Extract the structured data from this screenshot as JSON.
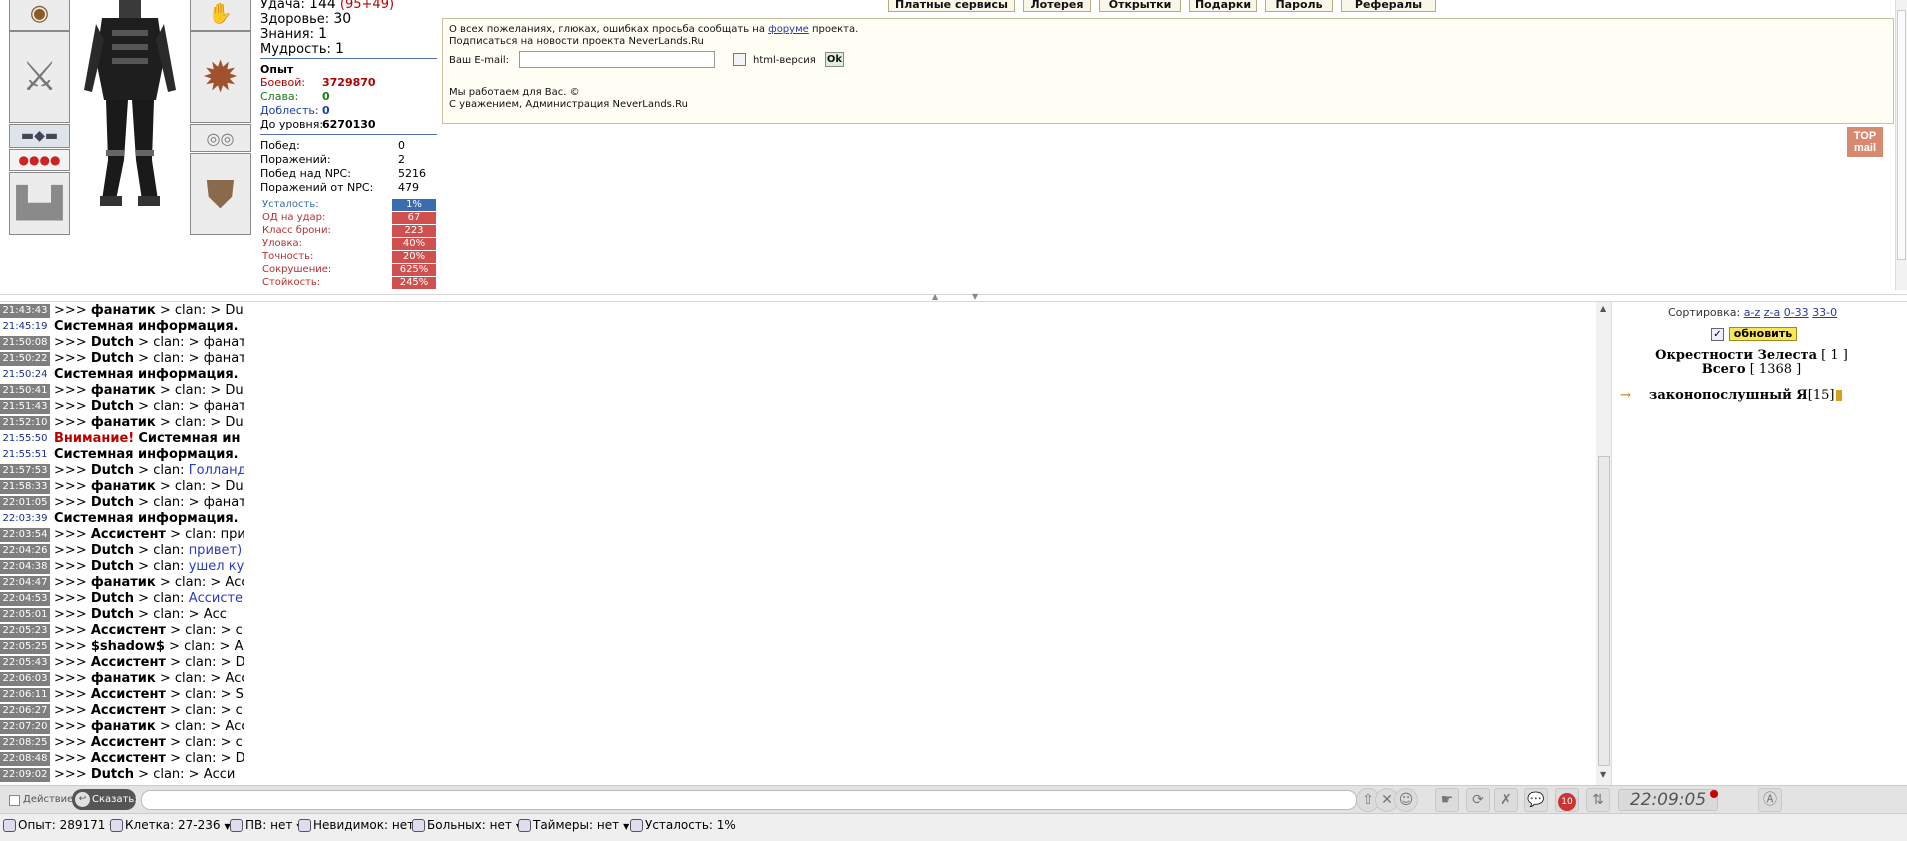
{
  "character": {
    "stats": [
      {
        "label": "Удача:",
        "value": "144",
        "extra": "(95+49)"
      },
      {
        "label": "Здоровье:",
        "value": "30"
      },
      {
        "label": "Знания:",
        "value": "1"
      },
      {
        "label": "Мудрость:",
        "value": "1"
      }
    ],
    "exp_title": "Опыт",
    "exp": [
      {
        "label": "Боевой:",
        "value": "3729870",
        "color": "#b00000"
      },
      {
        "label": "Слава:",
        "value": "0",
        "color": "#1b7a1b"
      },
      {
        "label": "Доблесть:",
        "value": "0",
        "color": "#1a3fa8"
      },
      {
        "label": "До уровня:",
        "value": "6270130",
        "color": "#000000"
      }
    ],
    "battles": [
      {
        "label": "Побед:",
        "value": "0"
      },
      {
        "label": "Поражений:",
        "value": "2"
      },
      {
        "label": "Побед над NPC:",
        "value": "5216"
      },
      {
        "label": "Поражений от NPC:",
        "value": "479"
      }
    ],
    "modifiers": [
      {
        "label": "Усталость:",
        "value": "1%",
        "color": "#3a6cb0"
      },
      {
        "label": "ОД на удар:",
        "value": "67",
        "color": "#d05050"
      },
      {
        "label": "Класс брони:",
        "value": "223",
        "color": "#d05050"
      },
      {
        "label": "Уловка:",
        "value": "40%",
        "color": "#d05050"
      },
      {
        "label": "Точность:",
        "value": "20%",
        "color": "#d05050"
      },
      {
        "label": "Сокрушение:",
        "value": "625%",
        "color": "#d05050"
      },
      {
        "label": "Стойкость:",
        "value": "245%",
        "color": "#d05050"
      }
    ],
    "equipment_icons": [
      "helmet-icon",
      "axe-icon",
      "belt-icon",
      "potions-icon",
      "boots-icon",
      "gauntlet-icon",
      "spiked-shield-icon",
      "rings-icon",
      "armor-icon"
    ]
  },
  "tabs": [
    "Платные сервисы",
    "Лотерея",
    "Открытки",
    "Подарки",
    "Пароль",
    "Рефералы"
  ],
  "news": {
    "line1_before": "О всех пожеланиях, глюках, ошибках просьба сообщать на",
    "line1_link": "форуме",
    "line1_after": "проекта.",
    "line2": "Подписаться на новости проекта NeverLands.Ru",
    "email_label": "Ваш E-mail:",
    "email_value": "",
    "html_label": "html-версия",
    "ok": "Ok",
    "footer1": "Мы работаем для Вас. ©",
    "footer2": "С уважением, Администрация NeverLands.Ru",
    "topmail": "TOP mail"
  },
  "chat": [
    {
      "time": "21:43:43",
      "ts": "g",
      "parts": [
        [
          ">>> ",
          ""
        ],
        [
          "фанатик",
          "b"
        ],
        [
          " > clan: > Dut",
          ""
        ]
      ]
    },
    {
      "time": "21:45:19",
      "ts": "b",
      "parts": [
        [
          "Системная информация.",
          "b"
        ]
      ]
    },
    {
      "time": "21:50:08",
      "ts": "g",
      "parts": [
        [
          ">>> ",
          ""
        ],
        [
          "Dutch",
          "b"
        ],
        [
          " > clan: > фанат",
          ""
        ]
      ]
    },
    {
      "time": "21:50:22",
      "ts": "g",
      "parts": [
        [
          ">>> ",
          ""
        ],
        [
          "Dutch",
          "b"
        ],
        [
          " > clan: > фанат",
          ""
        ]
      ]
    },
    {
      "time": "21:50:24",
      "ts": "b",
      "parts": [
        [
          "Системная информация.",
          "b"
        ]
      ]
    },
    {
      "time": "21:50:41",
      "ts": "g",
      "parts": [
        [
          ">>> ",
          ""
        ],
        [
          "фанатик",
          "b"
        ],
        [
          " > clan: > Dut",
          ""
        ]
      ]
    },
    {
      "time": "21:51:43",
      "ts": "g",
      "parts": [
        [
          ">>> ",
          ""
        ],
        [
          "Dutch",
          "b"
        ],
        [
          " > clan: > фанат",
          ""
        ]
      ]
    },
    {
      "time": "21:52:10",
      "ts": "g",
      "parts": [
        [
          ">>> ",
          ""
        ],
        [
          "фанатик",
          "b"
        ],
        [
          " > clan: > Dut",
          ""
        ]
      ]
    },
    {
      "time": "21:55:50",
      "ts": "b",
      "parts": [
        [
          "Внимание!",
          "red"
        ],
        [
          " ",
          ""
        ],
        [
          "Системная ин",
          "b"
        ]
      ]
    },
    {
      "time": "21:55:51",
      "ts": "b",
      "parts": [
        [
          "Системная информация.",
          "b"
        ]
      ]
    },
    {
      "time": "21:57:53",
      "ts": "g",
      "parts": [
        [
          ">>> ",
          ""
        ],
        [
          "Dutch",
          "b"
        ],
        [
          " > clan: ",
          ""
        ],
        [
          "Голланд",
          "blue"
        ]
      ]
    },
    {
      "time": "21:58:33",
      "ts": "g",
      "parts": [
        [
          ">>> ",
          ""
        ],
        [
          "фанатик",
          "b"
        ],
        [
          " > clan: > Dut",
          ""
        ]
      ]
    },
    {
      "time": "22:01:05",
      "ts": "g",
      "parts": [
        [
          ">>> ",
          ""
        ],
        [
          "Dutch",
          "b"
        ],
        [
          " > clan: > фанат",
          ""
        ]
      ]
    },
    {
      "time": "22:03:39",
      "ts": "b",
      "parts": [
        [
          "Системная информация.",
          "b"
        ]
      ]
    },
    {
      "time": "22:03:54",
      "ts": "g",
      "parts": [
        [
          ">>> ",
          ""
        ],
        [
          "Ассистент",
          "b"
        ],
        [
          " > clan: при",
          ""
        ]
      ]
    },
    {
      "time": "22:04:26",
      "ts": "g",
      "parts": [
        [
          ">>> ",
          ""
        ],
        [
          "Dutch",
          "b"
        ],
        [
          " > clan: ",
          ""
        ],
        [
          "привет)",
          "blue"
        ]
      ]
    },
    {
      "time": "22:04:38",
      "ts": "g",
      "parts": [
        [
          ">>> ",
          ""
        ],
        [
          "Dutch",
          "b"
        ],
        [
          " > clan: ",
          ""
        ],
        [
          "ушел ку",
          "blue"
        ]
      ]
    },
    {
      "time": "22:04:47",
      "ts": "g",
      "parts": [
        [
          ">>> ",
          ""
        ],
        [
          "фанатик",
          "b"
        ],
        [
          " > clan: > Асс",
          ""
        ]
      ]
    },
    {
      "time": "22:04:53",
      "ts": "g",
      "parts": [
        [
          ">>> ",
          ""
        ],
        [
          "Dutch",
          "b"
        ],
        [
          " > clan: ",
          ""
        ],
        [
          "Ассисте",
          "blue"
        ]
      ]
    },
    {
      "time": "22:05:01",
      "ts": "g",
      "parts": [
        [
          ">>> ",
          ""
        ],
        [
          "Dutch",
          "b"
        ],
        [
          " > clan: > Асс",
          ""
        ]
      ]
    },
    {
      "time": "22:05:23",
      "ts": "g",
      "parts": [
        [
          ">>> ",
          ""
        ],
        [
          "Ассистент",
          "b"
        ],
        [
          " > clan: > с",
          ""
        ]
      ]
    },
    {
      "time": "22:05:25",
      "ts": "g",
      "parts": [
        [
          ">>> ",
          ""
        ],
        [
          "$shadow$",
          "b"
        ],
        [
          " > clan: > А",
          ""
        ]
      ]
    },
    {
      "time": "22:05:43",
      "ts": "g",
      "parts": [
        [
          ">>> ",
          ""
        ],
        [
          "Ассистент",
          "b"
        ],
        [
          " > clan: > D",
          ""
        ]
      ]
    },
    {
      "time": "22:06:03",
      "ts": "g",
      "parts": [
        [
          ">>> ",
          ""
        ],
        [
          "фанатик",
          "b"
        ],
        [
          " > clan: > Асс",
          ""
        ]
      ]
    },
    {
      "time": "22:06:11",
      "ts": "g",
      "parts": [
        [
          ">>> ",
          ""
        ],
        [
          "Ассистент",
          "b"
        ],
        [
          " > clan: > S",
          ""
        ]
      ]
    },
    {
      "time": "22:06:27",
      "ts": "g",
      "parts": [
        [
          ">>> ",
          ""
        ],
        [
          "Ассистент",
          "b"
        ],
        [
          " > clan: > с",
          ""
        ]
      ]
    },
    {
      "time": "22:07:20",
      "ts": "g",
      "parts": [
        [
          ">>> ",
          ""
        ],
        [
          "фанатик",
          "b"
        ],
        [
          " > clan: > Асс",
          ""
        ]
      ]
    },
    {
      "time": "22:08:25",
      "ts": "g",
      "parts": [
        [
          ">>> ",
          ""
        ],
        [
          "Ассистент",
          "b"
        ],
        [
          " > clan: > с",
          ""
        ]
      ]
    },
    {
      "time": "22:08:48",
      "ts": "g",
      "parts": [
        [
          ">>> ",
          ""
        ],
        [
          "Ассистент",
          "b"
        ],
        [
          " > clan: > D",
          ""
        ]
      ]
    },
    {
      "time": "22:09:02",
      "ts": "g",
      "parts": [
        [
          ">>> ",
          ""
        ],
        [
          "Dutch",
          "b"
        ],
        [
          " > clan: > Асси",
          ""
        ]
      ]
    }
  ],
  "online": {
    "sort_label": "Сортировка:",
    "sort_options": [
      "a-z",
      "z-a",
      "0-33",
      "33-0"
    ],
    "refresh": "обновить",
    "location": "Окрестности Зелеста",
    "location_count": "[ 1 ]",
    "total_label": "Всего",
    "total_count": "[ 1368 ]",
    "player": {
      "name": "законопослушный Я",
      "level": "[15]"
    }
  },
  "input": {
    "action_label": "Действие",
    "say_label": "Сказать:",
    "value": "",
    "clock": "22:09:05",
    "msg_count": "10"
  },
  "status": [
    {
      "icon": "experience-icon",
      "text": "Опыт: 289171",
      "dropdown": true
    },
    {
      "icon": "cell-icon",
      "text": "Клетка: 27-236",
      "dropdown": true
    },
    {
      "icon": "pv-icon",
      "text": "ПВ: нет",
      "dropdown": true
    },
    {
      "icon": "invisible-icon",
      "text": "Невидимок: нет",
      "dropdown": false
    },
    {
      "icon": "sick-icon",
      "text": "Больных: нет",
      "dropdown": true
    },
    {
      "icon": "timer-icon",
      "text": "Таймеры: нет",
      "dropdown": true
    },
    {
      "icon": "fatigue-drop-icon",
      "text": "Усталость: 1%",
      "dropdown": false
    }
  ]
}
